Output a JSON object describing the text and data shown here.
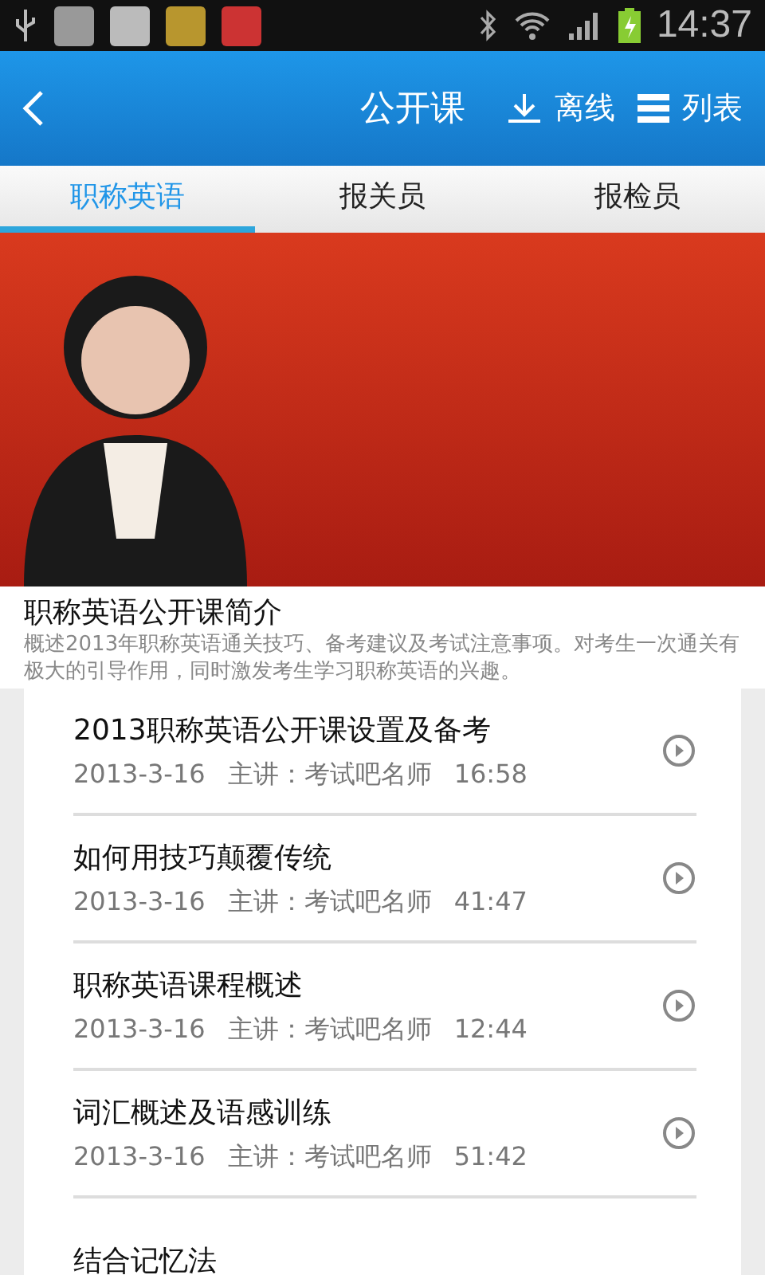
{
  "status_bar": {
    "time": "14:37"
  },
  "header": {
    "title": "公开课",
    "actions": [
      {
        "kind": "download",
        "label": "离线"
      },
      {
        "kind": "list",
        "label": "列表"
      }
    ]
  },
  "tabs": [
    {
      "label": "职称英语",
      "selected": true
    },
    {
      "label": "报关员",
      "selected": false
    },
    {
      "label": "报检员",
      "selected": false
    }
  ],
  "intro": {
    "title": "职称英语公开课简介",
    "description": "概述2013年职称英语通关技巧、备考建议及考试注意事项。对考生一次通关有极大的引导作用，同时激发考生学习职称英语的兴趣。"
  },
  "lessons": [
    {
      "title": "2013职称英语公开课设置及备考",
      "date": "2013-3-16",
      "speaker": "主讲：考试吧名师",
      "duration": "16:58"
    },
    {
      "title": "如何用技巧颠覆传统",
      "date": "2013-3-16",
      "speaker": "主讲：考试吧名师",
      "duration": "41:47"
    },
    {
      "title": "职称英语课程概述",
      "date": "2013-3-16",
      "speaker": "主讲：考试吧名师",
      "duration": "12:44"
    },
    {
      "title": "词汇概述及语感训练",
      "date": "2013-3-16",
      "speaker": "主讲：考试吧名师",
      "duration": "51:42"
    },
    {
      "title": "结合记忆法"
    }
  ]
}
